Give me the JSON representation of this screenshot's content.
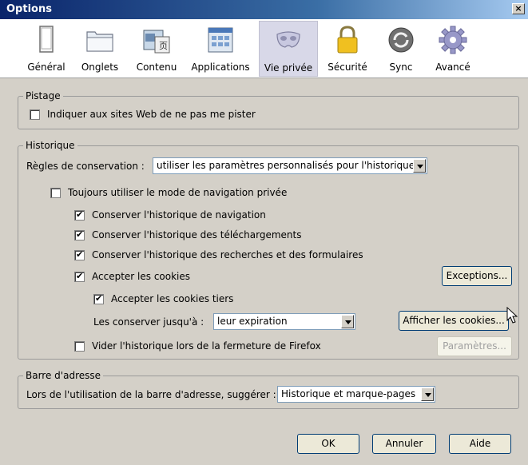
{
  "window": {
    "title": "Options",
    "close_label": "×"
  },
  "toolbar": {
    "items": [
      {
        "label": "Général",
        "icon": "general-icon"
      },
      {
        "label": "Onglets",
        "icon": "tabs-icon"
      },
      {
        "label": "Contenu",
        "icon": "content-icon"
      },
      {
        "label": "Applications",
        "icon": "applications-icon"
      },
      {
        "label": "Vie privée",
        "icon": "privacy-mask-icon",
        "selected": true
      },
      {
        "label": "Sécurité",
        "icon": "lock-icon"
      },
      {
        "label": "Sync",
        "icon": "sync-icon"
      },
      {
        "label": "Avancé",
        "icon": "gear-icon"
      }
    ]
  },
  "pistage": {
    "legend": "Pistage",
    "dnt_label": "Indiquer aux sites Web de ne pas me pister",
    "dnt_checked": false
  },
  "historique": {
    "legend": "Historique",
    "rules_label": "Règles de conservation :",
    "rules_value": "utiliser les paramètres personnalisés pour l'historique",
    "private_label": "Toujours utiliser le mode de navigation privée",
    "nav_history_label": "Conserver l'historique de navigation",
    "downloads_label": "Conserver l'historique des téléchargements",
    "search_forms_label": "Conserver l'historique des recherches et des formulaires",
    "cookies_label": "Accepter les cookies",
    "exceptions_button": "Exceptions...",
    "third_party_label": "Accepter les cookies tiers",
    "keep_until_label": "Les conserver jusqu'à :",
    "keep_until_value": "leur expiration",
    "show_cookies_button": "Afficher les cookies...",
    "clear_on_close_label": "Vider l'historique lors de la fermeture de Firefox",
    "settings_button": "Paramètres..."
  },
  "adresse": {
    "legend": "Barre d'adresse",
    "suggest_label": "Lors de l'utilisation de la barre d'adresse, suggérer :",
    "suggest_value": "Historique et marque-pages"
  },
  "footer": {
    "ok": "OK",
    "cancel": "Annuler",
    "help": "Aide"
  }
}
